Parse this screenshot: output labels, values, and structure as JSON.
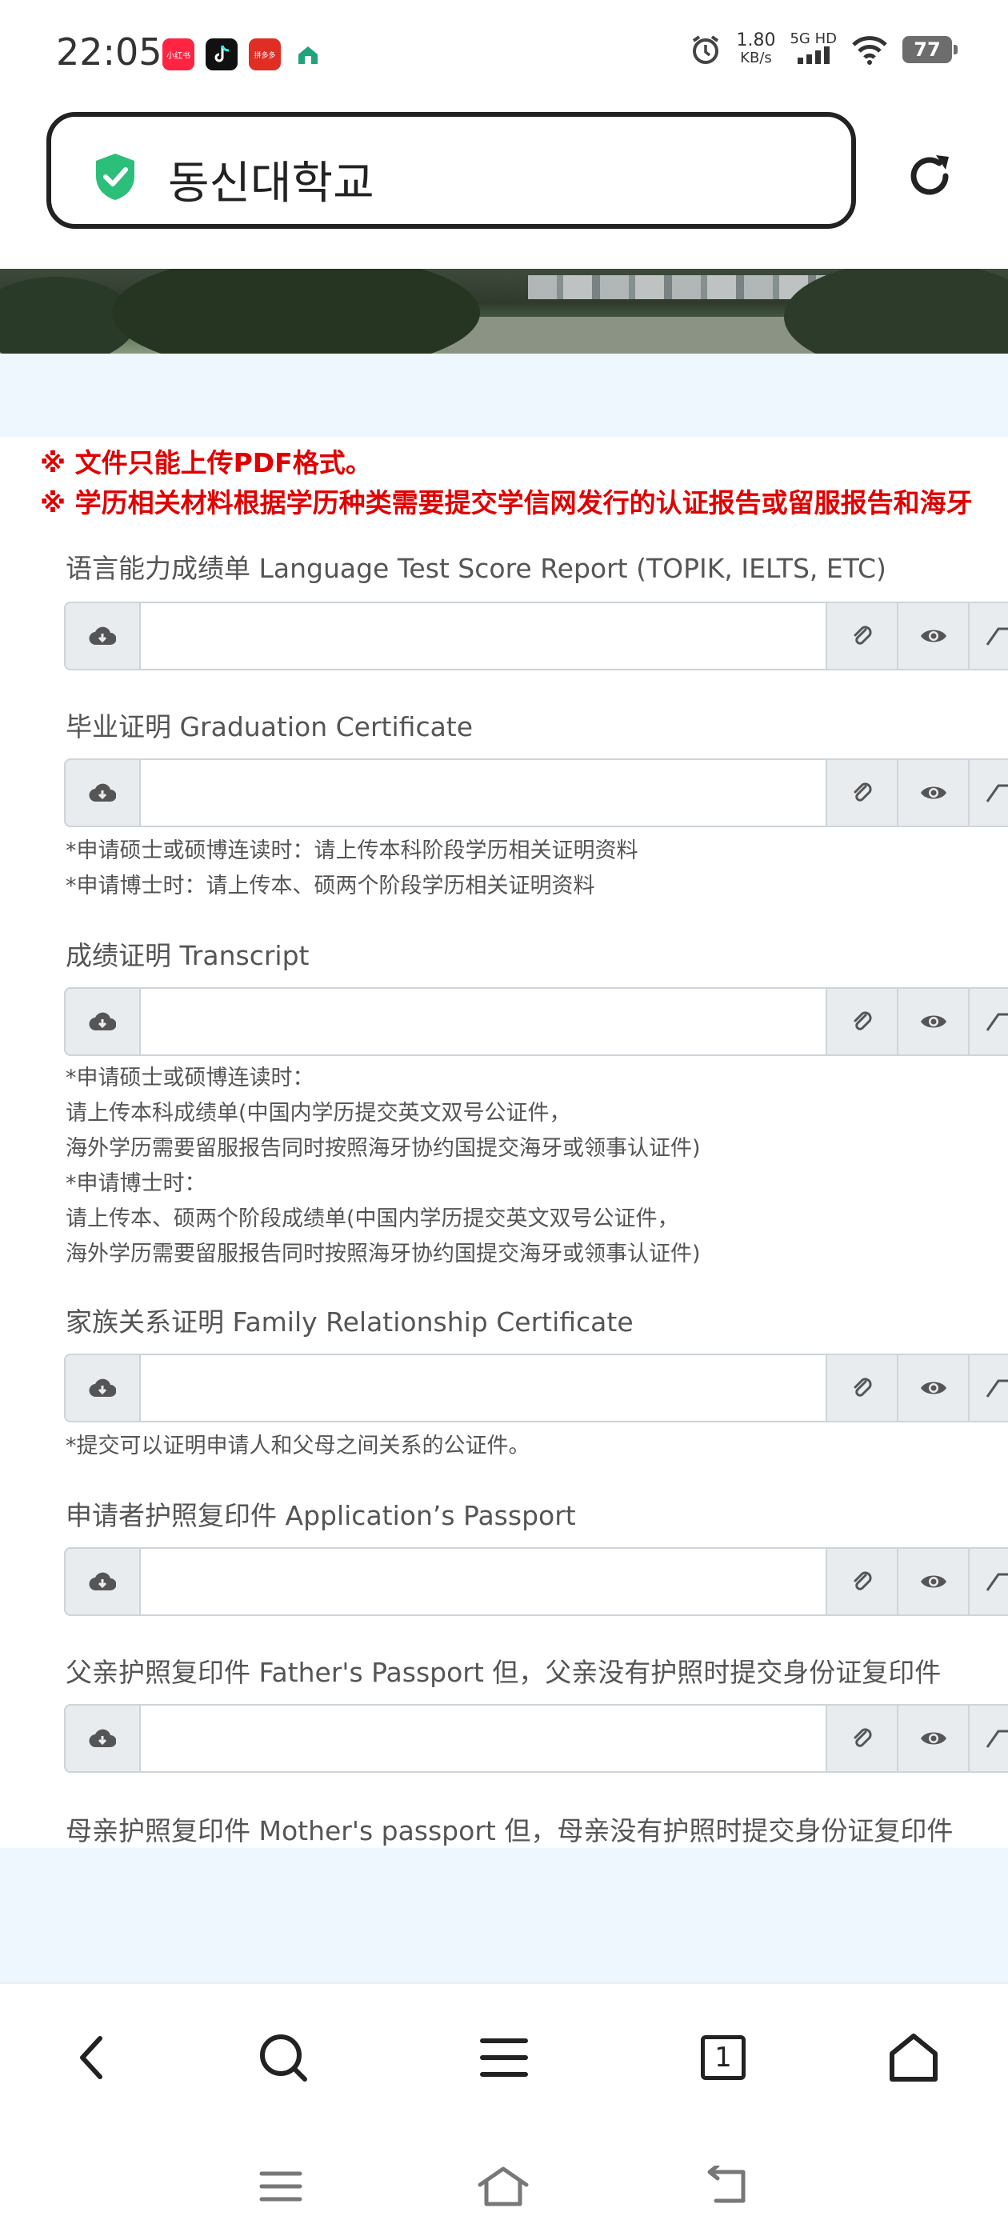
{
  "status_bar": {
    "time": "22:05",
    "notifications": [
      {
        "name": "xiaohongshu-app-icon",
        "label": "小红书",
        "color": "#ff2442"
      },
      {
        "name": "tiktok-app-icon",
        "label": "",
        "color": "#111111"
      },
      {
        "name": "pinduoduo-app-icon",
        "label": "拼多多",
        "color": "#e02e24"
      },
      {
        "name": "home-app-icon",
        "label": "",
        "color": "#ffffff"
      }
    ],
    "net_speed_value": "1.80",
    "net_speed_unit": "KB/s",
    "network_type": "5G HD",
    "battery": "77"
  },
  "url_bar": {
    "url_text": "동신대학교",
    "secure_color": "#2bbf7a"
  },
  "notices": [
    "※ 文件只能上传PDF格式。",
    "※ 学历相关材料根据学历种类需要提交学信网发行的认证报告或留服报告和海牙"
  ],
  "fields": [
    {
      "label": "语言能力成绩单 Language Test Score Report (TOPIK, IELTS, ETC)",
      "helper": []
    },
    {
      "label": "毕业证明 Graduation Certificate",
      "helper": [
        "*申请硕士或硕博连读时：请上传本科阶段学历相关证明资料",
        "*申请博士时：请上传本、硕两个阶段学历相关证明资料"
      ]
    },
    {
      "label": "成绩证明 Transcript",
      "helper": [
        "*申请硕士或硕博连读时：",
        "请上传本科成绩单(中国内学历提交英文双号公证件，",
        "海外学历需要留服报告同时按照海牙协约国提交海牙或领事认证件)",
        "*申请博士时：",
        "请上传本、硕两个阶段成绩单(中国内学历提交英文双号公证件，",
        "海外学历需要留服报告同时按照海牙协约国提交海牙或领事认证件)"
      ]
    },
    {
      "label": "家族关系证明 Family Relationship Certificate",
      "helper": [
        "*提交可以证明申请人和父母之间关系的公证件。"
      ]
    },
    {
      "label": "申请者护照复印件 Application’s Passport",
      "helper": []
    },
    {
      "label": "父亲护照复印件 Father's Passport 但，父亲没有护照时提交身份证复印件",
      "helper": []
    },
    {
      "label": "母亲护照复印件 Mother's passport 但，母亲没有护照时提交身份证复印件",
      "helper": []
    }
  ],
  "toolbar": {
    "tab_count": "1"
  }
}
